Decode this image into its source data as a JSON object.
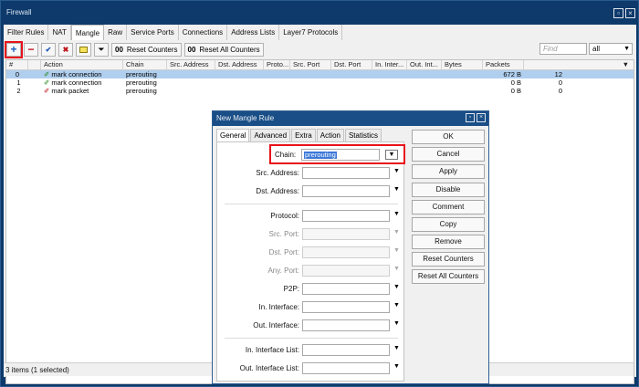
{
  "window": {
    "title": "Firewall"
  },
  "tabs": [
    "Filter Rules",
    "NAT",
    "Mangle",
    "Raw",
    "Service Ports",
    "Connections",
    "Address Lists",
    "Layer7 Protocols"
  ],
  "toolbar": {
    "reset_counters": "Reset Counters",
    "reset_all_counters": "Reset All Counters",
    "counter_prefix": "00",
    "find_placeholder": "Find",
    "filter_value": "all"
  },
  "table": {
    "columns": [
      "#",
      "Action",
      "Chain",
      "Src. Address",
      "Dst. Address",
      "Proto...",
      "Src. Port",
      "Dst. Port",
      "In. Inter...",
      "Out. Int...",
      "Bytes",
      "Packets"
    ],
    "rows": [
      {
        "num": "0",
        "action": "mark connection",
        "chain": "prerouting",
        "bytes": "672 B",
        "packets": "12",
        "selected": true
      },
      {
        "num": "1",
        "action": "mark connection",
        "chain": "prerouting",
        "bytes": "0 B",
        "packets": "0",
        "selected": false
      },
      {
        "num": "2",
        "action": "mark packet",
        "chain": "prerouting",
        "bytes": "0 B",
        "packets": "0",
        "selected": false
      }
    ]
  },
  "status": "3 items (1 selected)",
  "dialog": {
    "title": "New Mangle Rule",
    "tabs": [
      "General",
      "Advanced",
      "Extra",
      "Action",
      "Statistics"
    ],
    "chain_label": "Chain:",
    "chain_value": "prerouting",
    "fields": {
      "src_address": "Src. Address:",
      "dst_address": "Dst. Address:",
      "protocol": "Protocol:",
      "src_port": "Src. Port:",
      "dst_port": "Dst. Port:",
      "any_port": "Any. Port:",
      "p2p": "P2P:",
      "in_interface": "In. Interface:",
      "out_interface": "Out. Interface:",
      "in_interface_list": "In. Interface List:",
      "out_interface_list": "Out. Interface List:"
    },
    "buttons": {
      "ok": "OK",
      "cancel": "Cancel",
      "apply": "Apply",
      "disable": "Disable",
      "comment": "Comment",
      "copy": "Copy",
      "remove": "Remove",
      "reset_counters": "Reset Counters",
      "reset_all_counters": "Reset All Counters"
    }
  },
  "colors": {
    "highlight": "#e8101a",
    "selection": "#b0cfee",
    "titlebar": "#0d3a6b"
  }
}
